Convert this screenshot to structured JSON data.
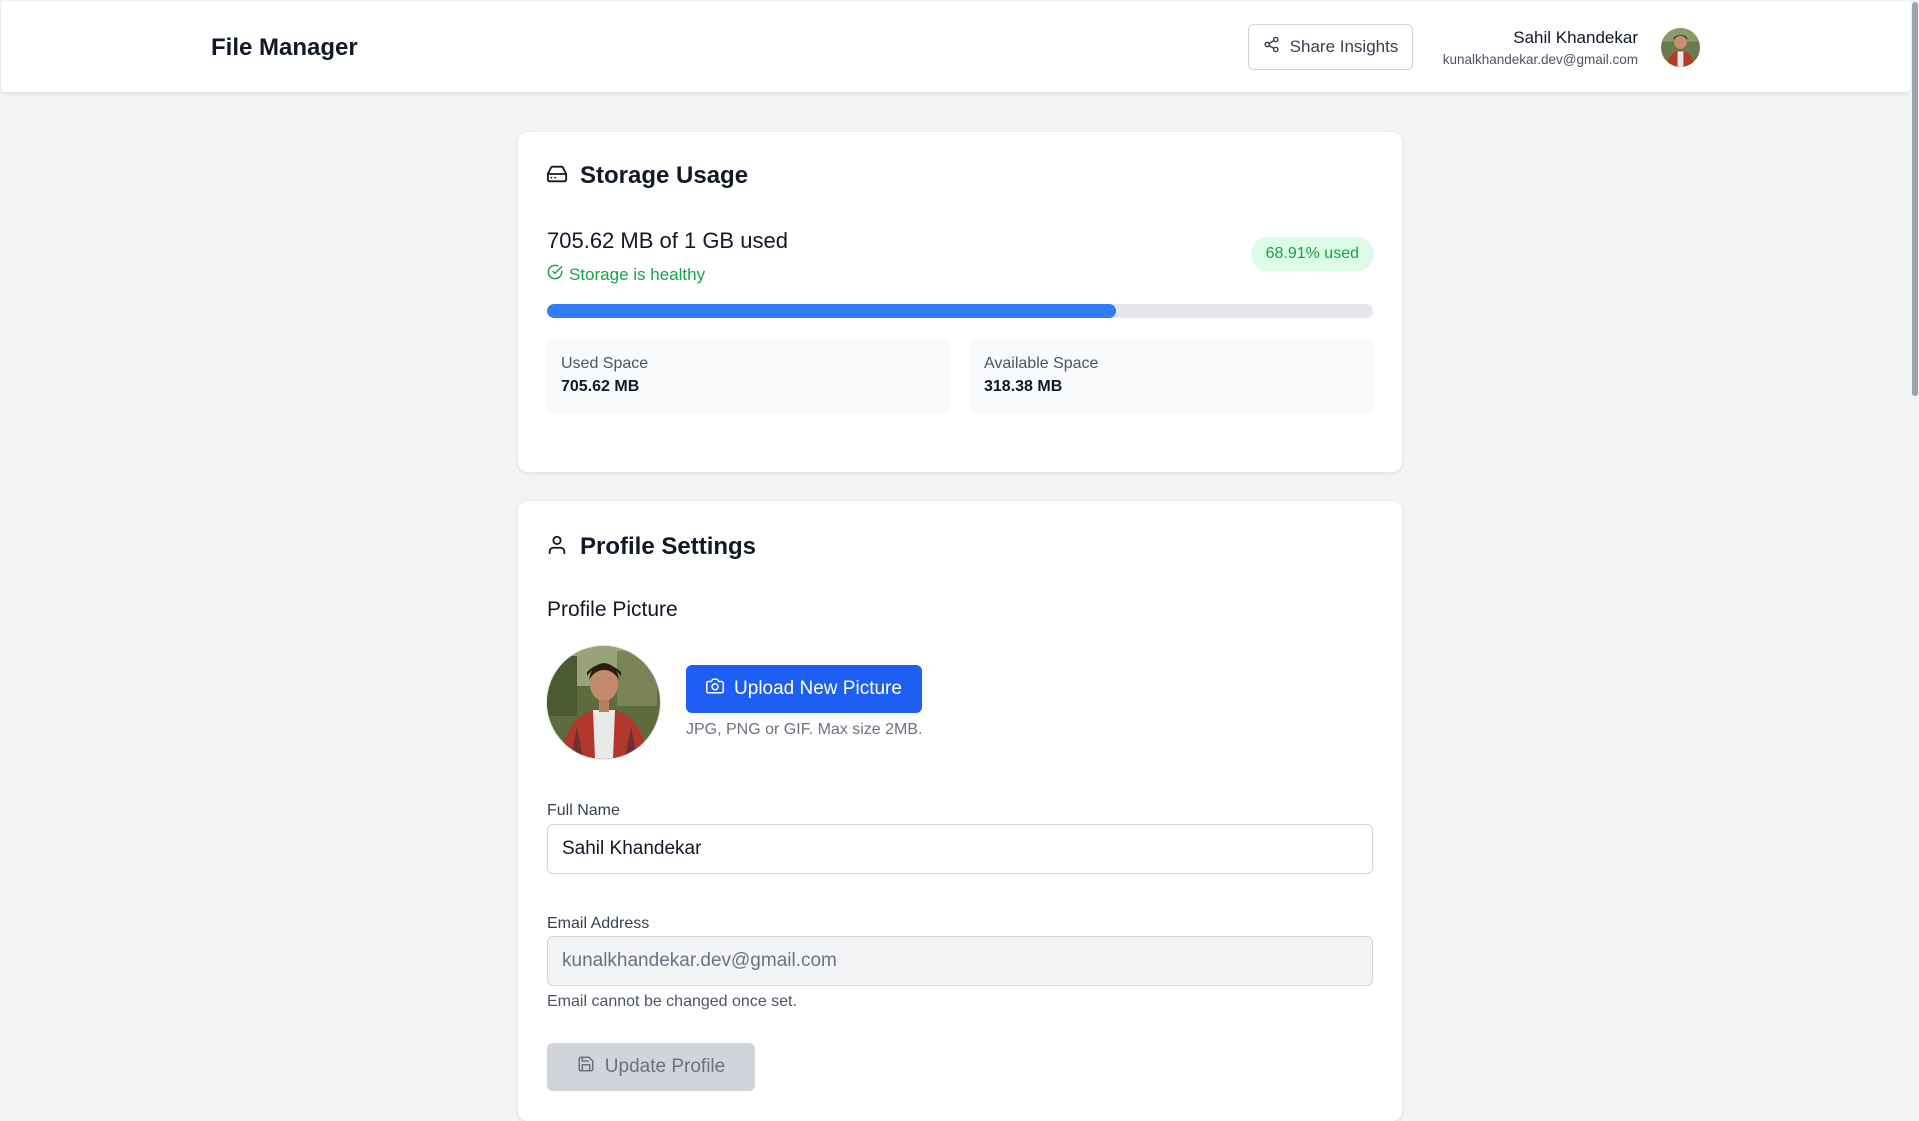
{
  "header": {
    "app_title": "File Manager",
    "share_label": "Share Insights",
    "user_name": "Sahil Khandekar",
    "user_email": "kunalkhandekar.dev@gmail.com"
  },
  "storage": {
    "title": "Storage Usage",
    "usage_text": "705.62 MB of 1 GB used",
    "status_text": "Storage is healthy",
    "percent_label": "68.91% used",
    "percent_value": 68.91,
    "used_label": "Used Space",
    "used_value": "705.62 MB",
    "available_label": "Available Space",
    "available_value": "318.38 MB"
  },
  "profile": {
    "title": "Profile Settings",
    "picture_label": "Profile Picture",
    "upload_label": "Upload New Picture",
    "upload_hint": "JPG, PNG or GIF. Max size 2MB.",
    "name_label": "Full Name",
    "name_value": "Sahil Khandekar",
    "email_label": "Email Address",
    "email_value": "kunalkhandekar.dev@gmail.com",
    "email_note": "Email cannot be changed once set.",
    "update_label": "Update Profile"
  },
  "colors": {
    "accent": "#1d5ef5",
    "progress": "#2f7cf6",
    "success": "#16a34a",
    "success_bg": "#dcfce7"
  },
  "icons": {
    "share": "share-icon",
    "storage": "hard-drive-icon",
    "healthy": "check-circle-icon",
    "profile": "user-icon",
    "upload": "camera-icon",
    "update": "save-icon"
  }
}
